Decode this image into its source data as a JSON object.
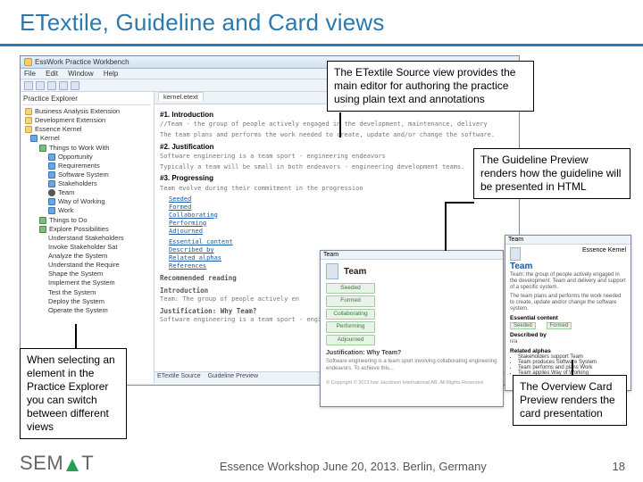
{
  "title": "ETextile, Guideline and Card views",
  "callouts": {
    "source_view": "The ETextile Source view provides the main editor for authoring the practice using plain text and annotations",
    "guideline_preview": "The Guideline Preview renders how the guideline will be presented in HTML",
    "explorer_select": "When selecting an element in the Practice Explorer you can switch between different views",
    "overview_card": "The Overview Card Preview renders the card presentation"
  },
  "ide": {
    "window_title": "EssWork Practice Workbench",
    "menu": [
      "File",
      "Edit",
      "Window",
      "Help"
    ],
    "explorer_title": "Practice Explorer",
    "tree": {
      "root1": "Business Analysis Extension",
      "root2": "Development Extension",
      "root3": "Essence Kernel",
      "kernel": "Kernel",
      "things": "Things to Work With",
      "items": [
        "Opportunity",
        "Requirements",
        "Software System",
        "Stakeholders",
        "Team",
        "Way of Working",
        "Work"
      ],
      "todo": "Things to Do",
      "explore": "Explore Possibilities",
      "sub": [
        "Understand Stakeholders",
        "Invoke Stakeholder Sat",
        "Analyze the System",
        "Understand the Require",
        "Shape the System",
        "Implement the System",
        "Test the System",
        "Deploy the System",
        "Operate the System"
      ]
    },
    "editor": {
      "tab": "kernel.etext",
      "h_intro": "#1. Introduction",
      "intro_line": "//Team - the group of people actively engaged in the development, maintenance, delivery",
      "h_just": "#2. Justification",
      "just_line": "Software engineering is a team sport - engineering endeavors",
      "h_prog": "#3. Progressing",
      "prog_line": "Team evolve during their commitment in the progression",
      "links": [
        "Seeded",
        "Formed",
        "Collaborating",
        "Performing",
        "Adjourned"
      ],
      "links2": [
        "Essential content",
        "Described by",
        "Related alphas",
        "References"
      ],
      "rec_reading": "Recommended reading",
      "sub_intro": "Introduction",
      "intro2": "Team: The group of people actively en",
      "sub_just": "Justification: Why Team?",
      "just2": "Software engineering is a team sport - engineering endeavors. To achieve this",
      "bottom_tabs": [
        "ETextile Source",
        "Guideline Preview"
      ]
    }
  },
  "guideline": {
    "tab": "Team",
    "title": "Team",
    "stages": [
      "Seeded",
      "Formed",
      "Collaborating",
      "Performing",
      "Adjourned"
    ],
    "sub": "Justification: Why Team?"
  },
  "overview": {
    "tab": "Team",
    "kernel_label": "Essence Kernel",
    "title": "Team",
    "desc": "Team: the group of people actively engaged in the development. Team and delivery and support of a specific system.",
    "desc2": "The team plans and performs the work needed to create, update and/or change the software system.",
    "sect_content": "Essential content",
    "sect_desc": "Described by",
    "na": "n/a",
    "sect_alphas": "Related alphas",
    "bullets": [
      "Stakeholders support Team",
      "Team produces Software System",
      "Team performs and plans Work",
      "Team applies Way of Working"
    ]
  },
  "footer": {
    "text": "Essence Workshop June 20, 2013. Berlin, Germany",
    "page": "18",
    "logo_pre": "SEM",
    "logo_post": "T"
  }
}
